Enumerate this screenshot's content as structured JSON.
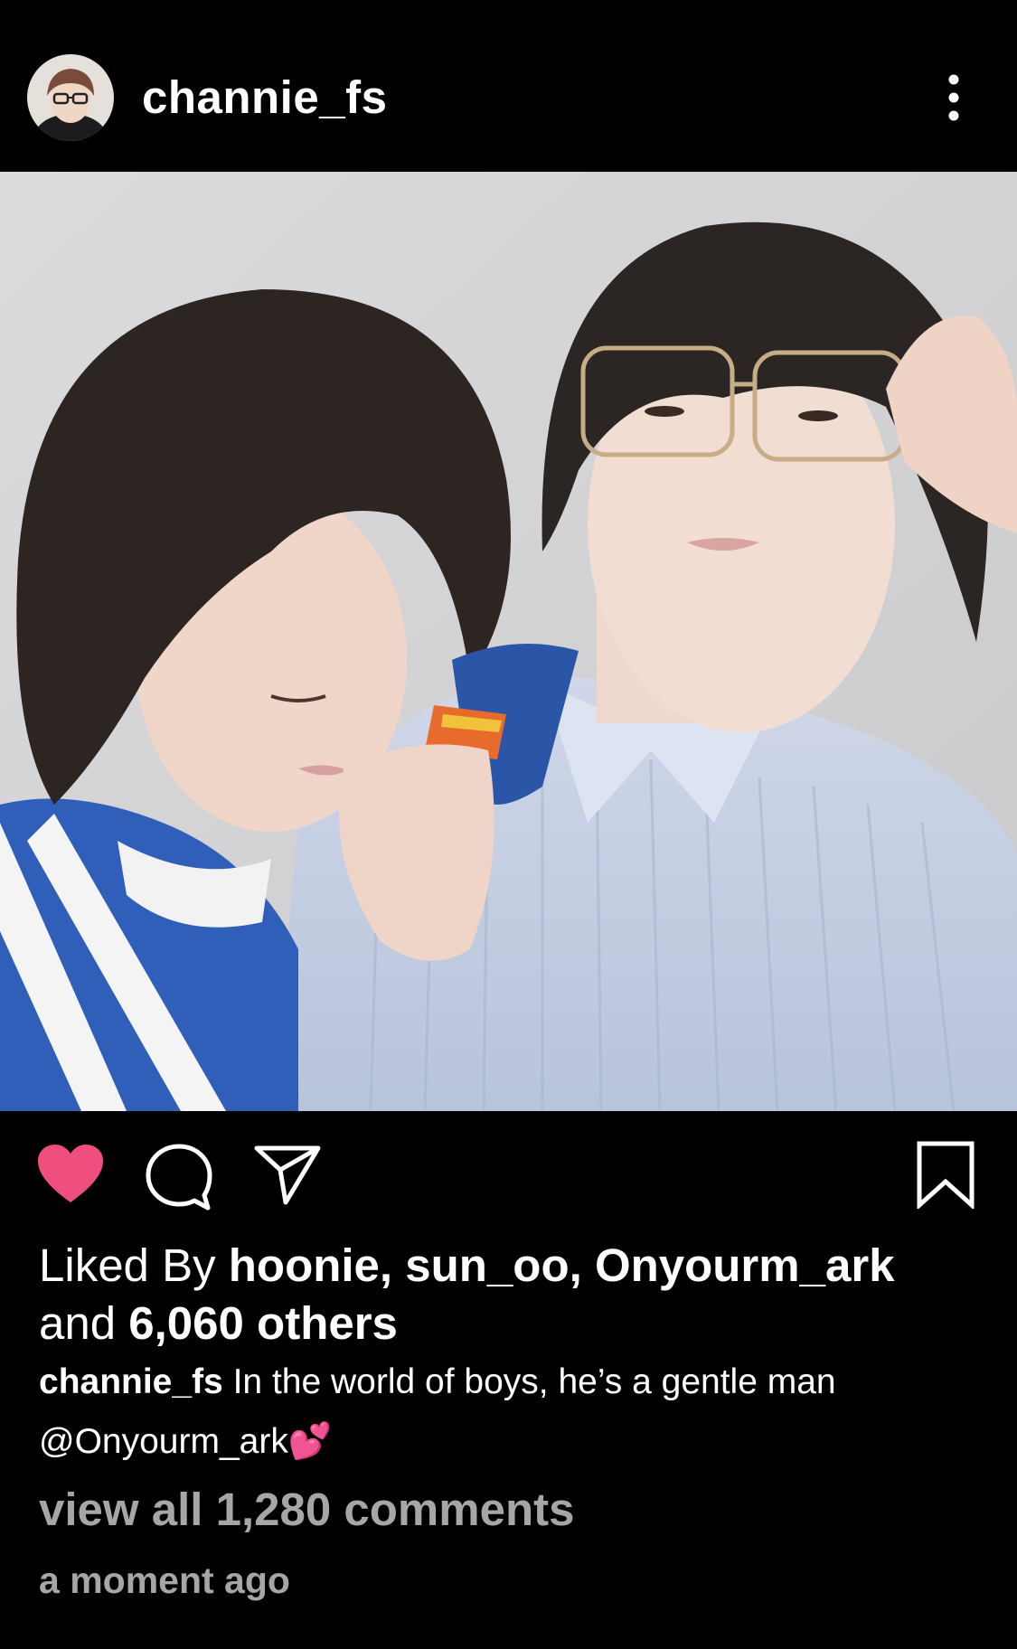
{
  "post": {
    "username": "channie_fs",
    "liked_by_prefix": "Liked By",
    "liked_by_users": "hoonie, sun_oo, Onyourm_ark",
    "liked_by_and": "and",
    "liked_by_others": "6,060 others",
    "caption_user": "channie_fs",
    "caption_text": "In the world of boys, he’s a gentle man",
    "caption_mention": "@Onyourm_ark",
    "caption_emoji": "💕",
    "view_all_comments": "view all 1,280 comments",
    "timestamp": "a moment ago"
  },
  "icons": {
    "avatar": "profile-avatar",
    "more": "more-vertical-icon",
    "like": "heart-filled-icon",
    "comment": "comment-bubble-icon",
    "share": "paper-plane-icon",
    "save": "bookmark-icon"
  },
  "colors": {
    "background": "#000000",
    "heart": "#ee4f7c",
    "muted_text": "#a6a6a6"
  }
}
